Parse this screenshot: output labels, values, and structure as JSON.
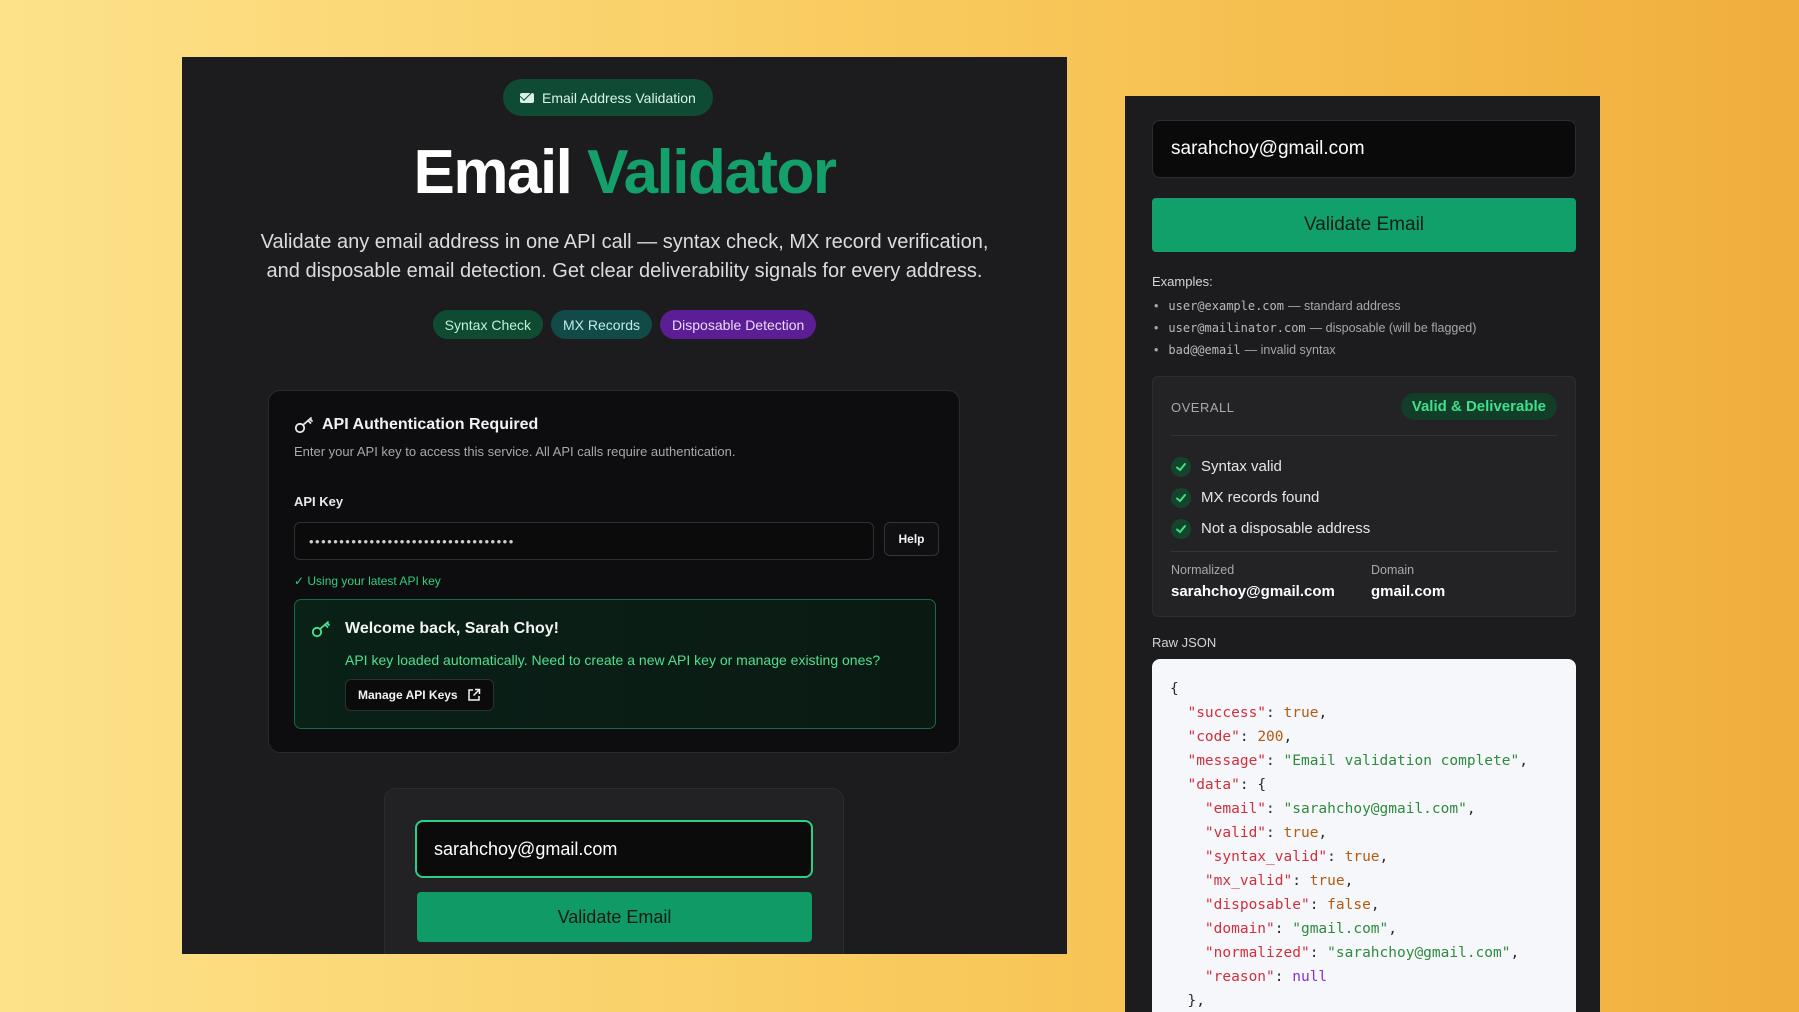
{
  "left": {
    "top_badge": "Email Address Validation",
    "title_part1": "Email",
    "title_part2": "Validator",
    "subtitle_line1": "Validate any email address in one API call — syntax check, MX record verification,",
    "subtitle_line2": "and disposable email detection. Get clear deliverability signals for every address.",
    "chips": [
      "Syntax Check",
      "MX Records",
      "Disposable Detection"
    ],
    "auth": {
      "title": "API Authentication Required",
      "description": "Enter your API key to access this service. All API calls require authentication.",
      "api_key_label": "API Key",
      "api_key_value": "••••••••••••••••••••••••••••••••••",
      "help_label": "Help",
      "status": "✓ Using your latest API key",
      "welcome_title": "Welcome back, Sarah Choy!",
      "welcome_desc": "API key loaded automatically. Need to create a new API key or manage existing ones?",
      "manage_label": "Manage API Keys"
    },
    "form": {
      "email_value": "sarahchoy@gmail.com",
      "validate_label": "Validate Email"
    }
  },
  "right": {
    "email_value": "sarahchoy@gmail.com",
    "validate_label": "Validate Email",
    "examples_label": "Examples:",
    "examples": [
      {
        "code": "user@example.com",
        "desc": "— standard address"
      },
      {
        "code": "user@mailinator.com",
        "desc": "— disposable (will be flagged)"
      },
      {
        "code": "bad@@email",
        "desc": "— invalid syntax"
      }
    ],
    "overall": {
      "label": "OVERALL",
      "badge": "Valid & Deliverable",
      "checks": [
        "Syntax valid",
        "MX records found",
        "Not a disposable address"
      ],
      "normalized_label": "Normalized",
      "normalized_value": "sarahchoy@gmail.com",
      "domain_label": "Domain",
      "domain_value": "gmail.com"
    },
    "raw_json_label": "Raw JSON",
    "raw_json": {
      "success": "true",
      "code": "200",
      "message": "\"Email validation complete\"",
      "email": "\"sarahchoy@gmail.com\"",
      "valid": "true",
      "syntax_valid": "true",
      "mx_valid": "true",
      "disposable": "false",
      "domain": "\"gmail.com\"",
      "normalized": "\"sarahchoy@gmail.com\"",
      "reason": "null"
    }
  },
  "colors": {
    "accent_green": "#14a06a",
    "success_text": "#3fe08a",
    "purple_chip": "#5b1e94"
  },
  "icons": {
    "badge_icon": "envelope-icon",
    "auth_icon": "key-icon",
    "welcome_icon": "key-icon",
    "manage_icon": "external-link-icon",
    "check_icon": "check-icon"
  }
}
